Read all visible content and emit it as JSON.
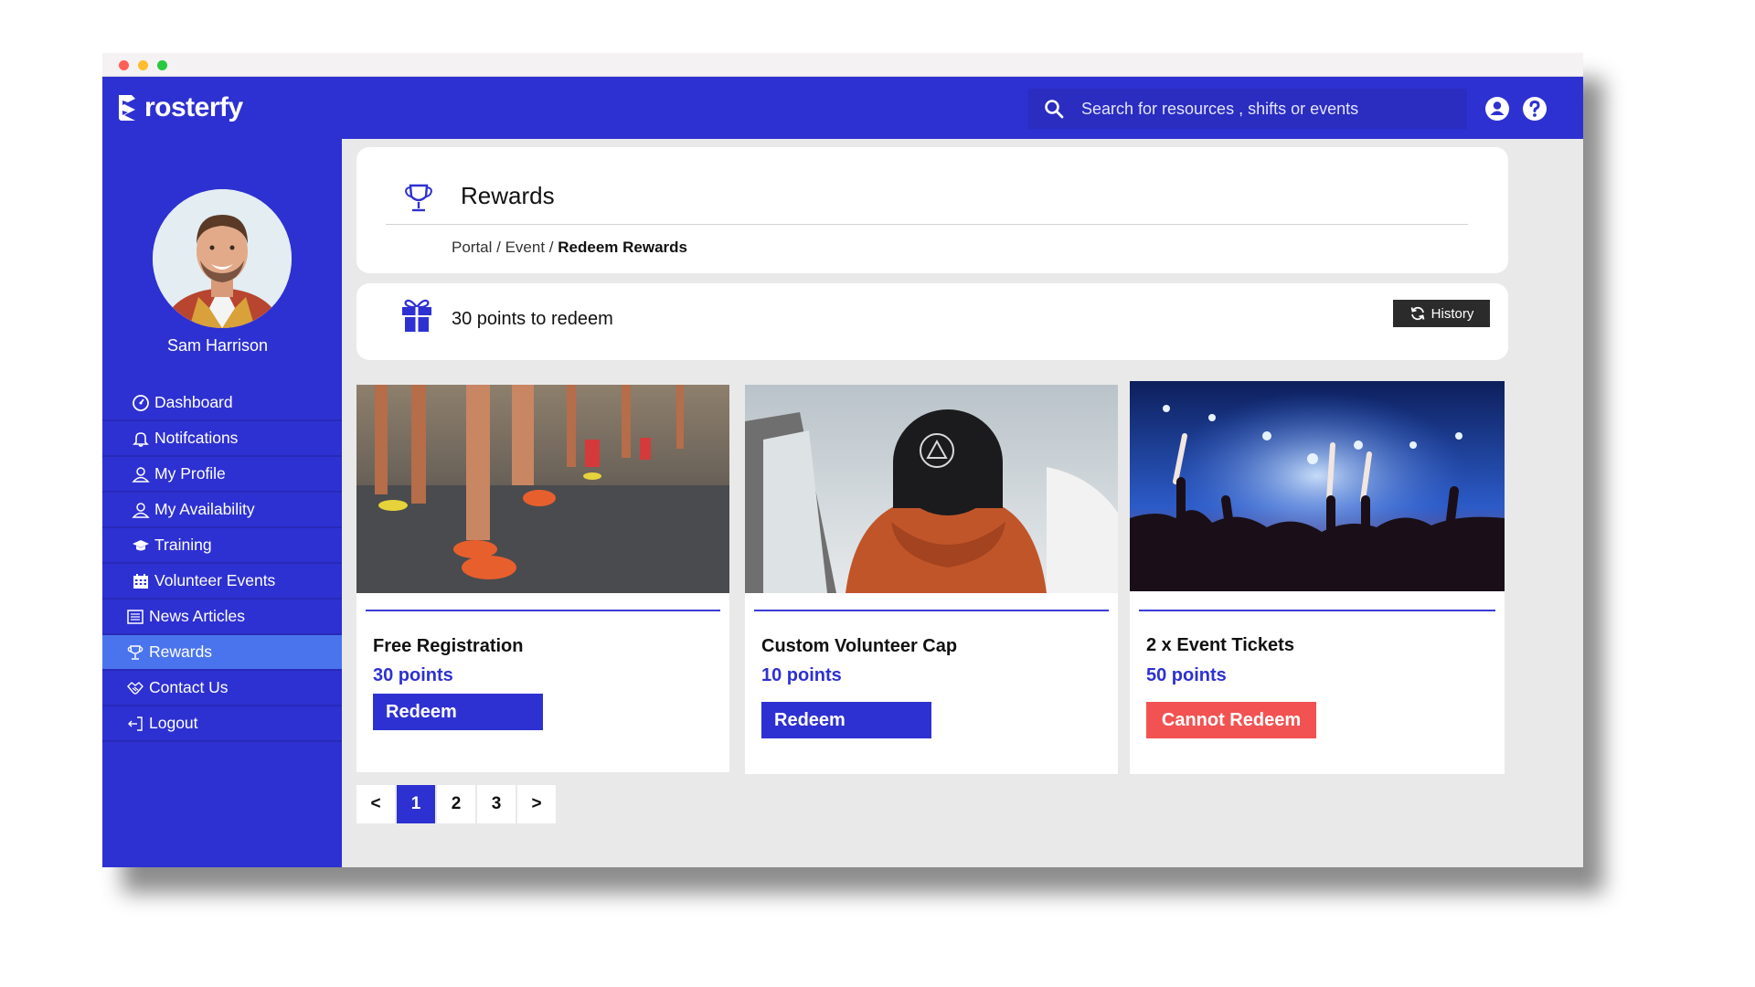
{
  "app": {
    "brand": "rosterfy"
  },
  "search": {
    "placeholder": "Search for resources , shifts or events"
  },
  "user": {
    "name": "Sam Harrison"
  },
  "sidebar": {
    "items": [
      {
        "label": "Dashboard",
        "icon": "dashboard-icon"
      },
      {
        "label": "Notifcations",
        "icon": "bell-icon"
      },
      {
        "label": "My Profile",
        "icon": "user-icon"
      },
      {
        "label": "My Availability",
        "icon": "user-icon"
      },
      {
        "label": "Training",
        "icon": "graduation-cap-icon"
      },
      {
        "label": "Volunteer Events",
        "icon": "calendar-icon"
      },
      {
        "label": "News Articles",
        "icon": "newspaper-icon"
      },
      {
        "label": "Rewards",
        "icon": "trophy-icon",
        "active": true
      },
      {
        "label": "Contact Us",
        "icon": "handshake-icon"
      },
      {
        "label": "Logout",
        "icon": "logout-icon"
      }
    ]
  },
  "page": {
    "title": "Rewards",
    "breadcrumb": {
      "a": "Portal",
      "sep1": " / ",
      "b": "Event",
      "sep2": " / ",
      "current": "Redeem Rewards"
    }
  },
  "points": {
    "text": "30 points to redeem",
    "history_label": "History"
  },
  "rewards": [
    {
      "name": "Free Registration",
      "points": "30 points",
      "button": "Redeem",
      "state": "available"
    },
    {
      "name": "Custom Volunteer Cap",
      "points": "10 points",
      "button": "Redeem",
      "state": "available"
    },
    {
      "name": "2 x Event Tickets",
      "points": "50 points",
      "button": "Cannot Redeem",
      "state": "unavailable"
    }
  ],
  "pagination": {
    "prev": "<",
    "pages": [
      "1",
      "2",
      "3"
    ],
    "next": ">",
    "current": "1"
  },
  "colors": {
    "brand": "#2e31d1",
    "active_nav": "#4a74ee",
    "danger": "#f25252",
    "dark_button": "#2b2b2b"
  }
}
